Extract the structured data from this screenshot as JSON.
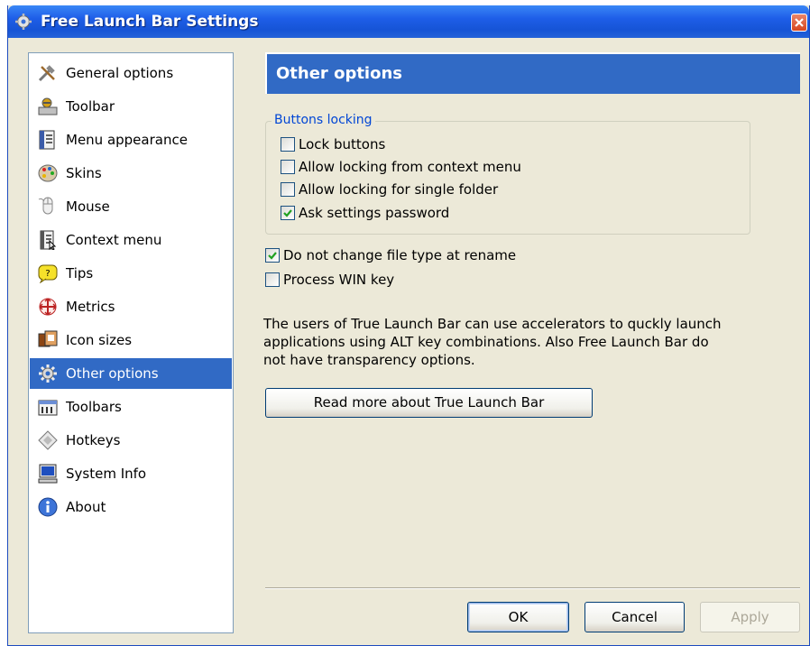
{
  "window": {
    "title": "Free Launch Bar Settings",
    "title_icon": "gear-icon"
  },
  "sidebar": {
    "items": [
      {
        "label": "General options",
        "icon": "tools-icon"
      },
      {
        "label": "Toolbar",
        "icon": "toolbar-icon"
      },
      {
        "label": "Menu appearance",
        "icon": "menu-icon"
      },
      {
        "label": "Skins",
        "icon": "palette-icon"
      },
      {
        "label": "Mouse",
        "icon": "mouse-icon"
      },
      {
        "label": "Context menu",
        "icon": "context-menu-icon"
      },
      {
        "label": "Tips",
        "icon": "tips-icon"
      },
      {
        "label": "Metrics",
        "icon": "metrics-icon"
      },
      {
        "label": "Icon sizes",
        "icon": "icon-sizes-icon"
      },
      {
        "label": "Other options",
        "icon": "gear-icon",
        "selected": true
      },
      {
        "label": "Toolbars",
        "icon": "toolbars-icon"
      },
      {
        "label": "Hotkeys",
        "icon": "hotkeys-icon"
      },
      {
        "label": "System Info",
        "icon": "computer-icon"
      },
      {
        "label": "About",
        "icon": "info-icon"
      }
    ]
  },
  "panel": {
    "title": "Other options",
    "group": {
      "label": "Buttons locking",
      "options": [
        {
          "label": "Lock buttons",
          "checked": false
        },
        {
          "label": "Allow locking from context menu",
          "checked": false
        },
        {
          "label": "Allow locking for single folder",
          "checked": false
        },
        {
          "label": "Ask settings password",
          "checked": true
        }
      ]
    },
    "options": [
      {
        "label": "Do not change file type at rename",
        "checked": true
      },
      {
        "label": "Process WIN key",
        "checked": false
      }
    ],
    "info_text": "The users of True Launch Bar can use accelerators to quckly launch applications using ALT key combinations. Also Free Launch Bar do not have transparency options.",
    "read_more_label": "Read more about True Launch Bar"
  },
  "footer": {
    "ok_label": "OK",
    "cancel_label": "Cancel",
    "apply_label": "Apply"
  },
  "colors": {
    "selection": "#316ac5",
    "titlebar": "#1e5ee8",
    "dialog_bg": "#ece9d8",
    "group_label": "#0046d5"
  }
}
